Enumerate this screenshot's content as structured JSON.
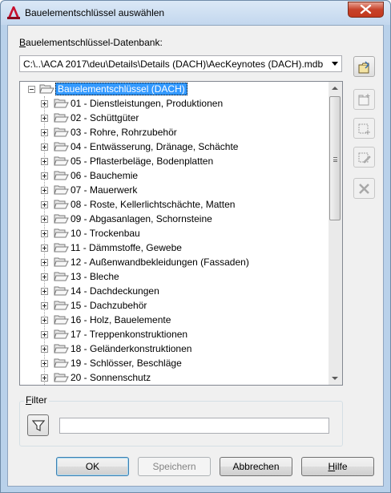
{
  "window": {
    "title": "Bauelementschlüssel auswählen",
    "app_icon": "autocad-architecture-icon",
    "close_icon": "close-icon"
  },
  "database": {
    "label_underlined": "B",
    "label_rest": "auelementschlüssel-Datenbank:",
    "selected_path": "C:\\..\\ACA 2017\\deu\\Details\\Details (DACH)\\AecKeynotes (DACH).mdb"
  },
  "side_buttons": [
    {
      "name": "open-database-icon",
      "enabled": true
    },
    {
      "name": "new-folder-icon",
      "enabled": false
    },
    {
      "name": "new-item-icon",
      "enabled": false
    },
    {
      "name": "edit-item-icon",
      "enabled": false
    },
    {
      "name": "delete-icon",
      "enabled": false
    }
  ],
  "tree": {
    "root": "Bauelementschlüssel (DACH)",
    "items": [
      "01 - Dienstleistungen, Produktionen",
      "02 - Schüttgüter",
      "03 - Rohre, Rohrzubehör",
      "04 - Entwässerung, Dränage, Schächte",
      "05 - Pflasterbeläge, Bodenplatten",
      "06 - Bauchemie",
      "07 - Mauerwerk",
      "08 - Roste, Kellerlichtschächte, Matten",
      "09 - Abgasanlagen, Schornsteine",
      "10 - Trockenbau",
      "11 - Dämmstoffe, Gewebe",
      "12 - Außenwandbekleidungen (Fassaden)",
      "13 - Bleche",
      "14 - Dachdeckungen",
      "15 - Dachzubehör",
      "16 - Holz, Bauelemente",
      "17 - Treppenkonstruktionen",
      "18 - Geländerkonstruktionen",
      "19 - Schlösser, Beschläge",
      "20 - Sonnenschutz"
    ]
  },
  "filter": {
    "label_underlined": "F",
    "label_rest": "ilter",
    "value": "",
    "icon": "funnel-icon"
  },
  "buttons": {
    "ok": "OK",
    "save": "Speichern",
    "cancel": "Abbrechen",
    "help_underlined": "H",
    "help_rest": "ilfe"
  }
}
